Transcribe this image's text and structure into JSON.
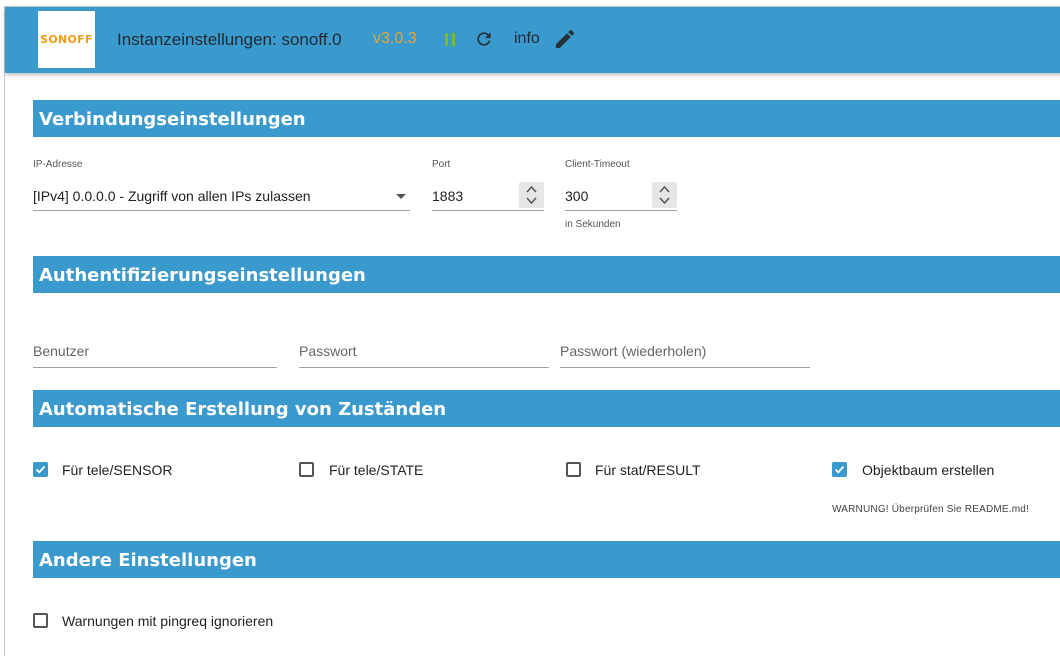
{
  "header": {
    "logo_text": "SONOFF",
    "title": "Instanzeinstellungen: sonoff.0",
    "version": "v3.0.3",
    "info_label": "info",
    "colors": {
      "bar": "#3a99cd",
      "version": "#e8a33c",
      "pause": "#7cb342"
    },
    "icons": [
      "pause-icon",
      "refresh-icon",
      "edit-icon"
    ]
  },
  "connection": {
    "heading": "Verbindungseinstellungen",
    "ip_label": "IP-Adresse",
    "ip_value": "[IPv4] 0.0.0.0 - Zugriff von allen IPs zulassen",
    "port_label": "Port",
    "port_value": "1883",
    "timeout_label": "Client-Timeout",
    "timeout_value": "300",
    "timeout_hint": "in Sekunden"
  },
  "auth": {
    "heading": "Authentifizierungseinstellungen",
    "user_placeholder": "Benutzer",
    "password_placeholder": "Passwort",
    "password_repeat_placeholder": "Passwort (wiederholen)"
  },
  "states": {
    "heading": "Automatische Erstellung von Zuständen",
    "options": [
      {
        "label": "Für tele/SENSOR",
        "checked": true
      },
      {
        "label": "Für tele/STATE",
        "checked": false
      },
      {
        "label": "Für stat/RESULT",
        "checked": false
      },
      {
        "label": "Objektbaum erstellen",
        "checked": true
      }
    ],
    "warning": "WARNUNG! Überprüfen Sie README.md!"
  },
  "other": {
    "heading": "Andere Einstellungen",
    "ignore_pingreq_label": "Warnungen mit pingreq ignorieren",
    "ignore_pingreq_checked": false
  }
}
